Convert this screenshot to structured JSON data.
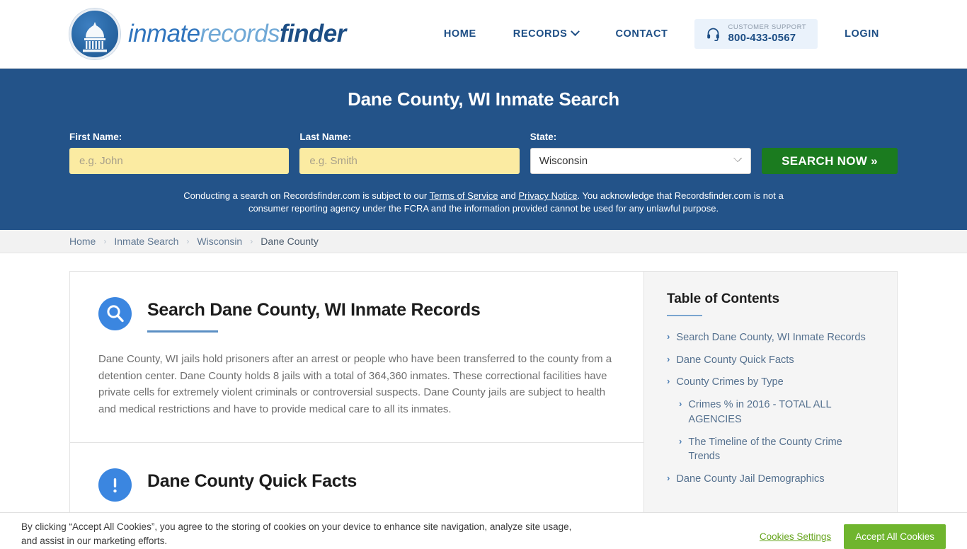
{
  "header": {
    "logo": {
      "icon": "capitol-dome-icon",
      "text_part1": "inmate",
      "text_part2": "records",
      "text_part3": "finder"
    },
    "nav": [
      {
        "label": "HOME",
        "has_caret": false
      },
      {
        "label": "RECORDS",
        "has_caret": true
      },
      {
        "label": "CONTACT",
        "has_caret": false
      }
    ],
    "support": {
      "icon": "headset-icon",
      "label": "CUSTOMER SUPPORT",
      "phone": "800-433-0567"
    },
    "login_label": "LOGIN"
  },
  "hero": {
    "title": "Dane County, WI Inmate Search",
    "first_name": {
      "label": "First Name:",
      "value": "",
      "placeholder": "e.g. John"
    },
    "last_name": {
      "label": "Last Name:",
      "value": "",
      "placeholder": "e.g. Smith"
    },
    "state": {
      "label": "State:",
      "value": "Wisconsin",
      "options": [
        "Wisconsin"
      ]
    },
    "search_button": "SEARCH NOW »",
    "disclaimer": {
      "part1": "Conducting a search on Recordsfinder.com is subject to our ",
      "link1": "Terms of Service",
      "part2": " and ",
      "link2": "Privacy Notice",
      "part3": ". You acknowledge that Recordsfinder.com is not a consumer reporting agency under the FCRA and the information provided cannot be used for any unlawful purpose."
    }
  },
  "breadcrumb": {
    "items": [
      "Home",
      "Inmate Search",
      "Wisconsin",
      "Dane County"
    ],
    "separator": "›"
  },
  "main": {
    "sections": [
      {
        "icon": "search-circle-icon",
        "title": "Search Dane County, WI Inmate Records",
        "body": "Dane County, WI jails hold prisoners after an arrest or people who have been transferred to the county from a detention center. Dane County holds 8 jails with a total of 364,360 inmates. These correctional facilities have private cells for extremely violent criminals or controversial suspects. Dane County jails are subject to health and medical restrictions and have to provide medical care to all its inmates."
      },
      {
        "icon": "alert-circle-icon",
        "title": "Dane County Quick Facts",
        "body": ""
      }
    ]
  },
  "toc": {
    "title": "Table of Contents",
    "items": [
      {
        "label": "Search Dane County, WI Inmate Records",
        "level": 1
      },
      {
        "label": "Dane County Quick Facts",
        "level": 1
      },
      {
        "label": "County Crimes by Type",
        "level": 1
      },
      {
        "label": "Crimes % in 2016 - TOTAL ALL AGENCIES",
        "level": 2
      },
      {
        "label": "The Timeline of the County Crime Trends",
        "level": 2
      },
      {
        "label": "Dane County Jail Demographics",
        "level": 1
      }
    ],
    "chevron": "›"
  },
  "cookie_banner": {
    "text": "By clicking “Accept All Cookies”, you agree to the storing of cookies on your device to enhance site navigation, analyze site usage, and assist in our marketing efforts.",
    "settings_label": "Cookies Settings",
    "accept_label": "Accept All Cookies"
  },
  "colors": {
    "hero_blue": "#235389",
    "brand_blue": "#1d4e85",
    "accent_blue": "#3b86e0",
    "search_green": "#1b7b1f",
    "cookie_green": "#6fb52e",
    "input_yellow": "#fbeba2"
  }
}
